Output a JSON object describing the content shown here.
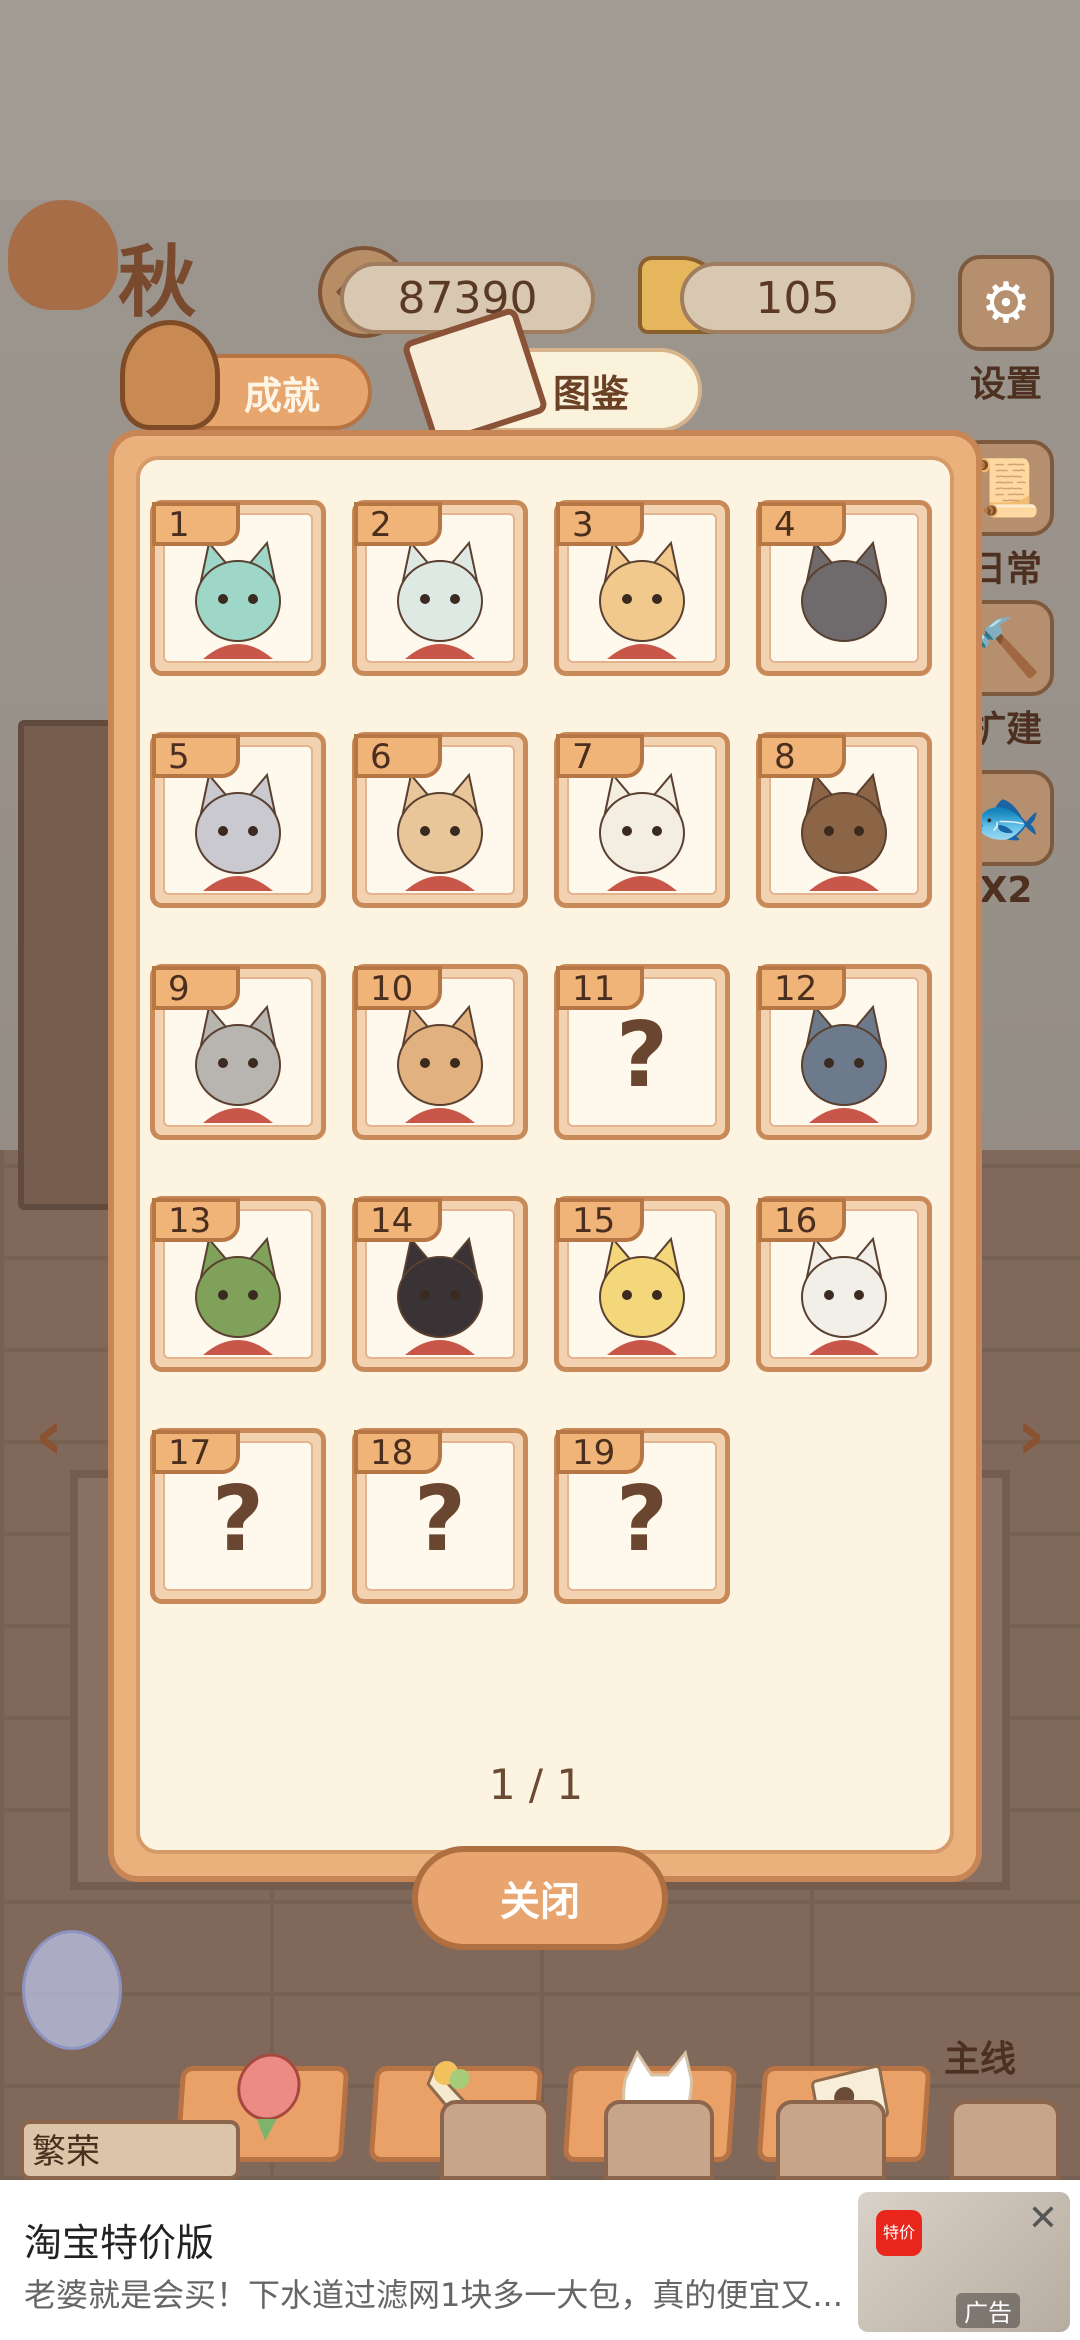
{
  "header": {
    "season": "秋",
    "fish_count": "87390",
    "cheese_count": "105"
  },
  "side_menu": {
    "settings": "设置",
    "daily": "日常",
    "build": "扩建",
    "double": "X2"
  },
  "tabs": {
    "achievements": "成就",
    "collection": "图鉴"
  },
  "collection": {
    "items": [
      {
        "number": "1",
        "unlocked": true,
        "character": "green-bird",
        "color": "#9ed7c8"
      },
      {
        "number": "2",
        "unlocked": true,
        "character": "white-dragon",
        "color": "#dfe9e4"
      },
      {
        "number": "3",
        "unlocked": true,
        "character": "unicorn-deer",
        "color": "#f2c98c"
      },
      {
        "number": "4",
        "unlocked": false,
        "silhouette": true,
        "character": "bear-silhouette",
        "color": "#6f6a6c"
      },
      {
        "number": "5",
        "unlocked": true,
        "character": "gray-cat",
        "color": "#c9c9cf"
      },
      {
        "number": "6",
        "unlocked": true,
        "character": "mouse-top-hat",
        "color": "#e8c69a"
      },
      {
        "number": "7",
        "unlocked": true,
        "character": "white-rabbit",
        "color": "#f4ede2"
      },
      {
        "number": "8",
        "unlocked": true,
        "character": "brown-bear",
        "color": "#8c6446"
      },
      {
        "number": "9",
        "unlocked": true,
        "character": "raccoon",
        "color": "#b8b4b0"
      },
      {
        "number": "10",
        "unlocked": true,
        "character": "fox-dog",
        "color": "#e1b17f"
      },
      {
        "number": "11",
        "unlocked": false,
        "label": "?"
      },
      {
        "number": "12",
        "unlocked": true,
        "character": "gray-wolf",
        "color": "#6c7a8c"
      },
      {
        "number": "13",
        "unlocked": true,
        "character": "cowboy-frog",
        "color": "#7fa15a"
      },
      {
        "number": "14",
        "unlocked": true,
        "character": "crow-hood",
        "color": "#3a3335"
      },
      {
        "number": "15",
        "unlocked": true,
        "character": "alpaca",
        "color": "#f4d77a"
      },
      {
        "number": "16",
        "unlocked": true,
        "character": "white-fox",
        "color": "#f2efe8"
      },
      {
        "number": "17",
        "unlocked": false,
        "label": "?"
      },
      {
        "number": "18",
        "unlocked": false,
        "label": "?"
      },
      {
        "number": "19",
        "unlocked": false,
        "label": "?"
      }
    ],
    "filters": [
      "rose-icon",
      "bouquet-icon",
      "cat-silhouette-icon",
      "photo-icon"
    ],
    "page": "1 / 1",
    "close_label": "关闭"
  },
  "bottom": {
    "fruitful_label": "繁荣",
    "mainline_label": "主线"
  },
  "ad": {
    "title": "淘宝特价版",
    "description": "老婆就是会买！下水道过滤网1块多一大包，真的便宜又...",
    "logo_text": "特价",
    "tag": "广告",
    "close": "✕"
  },
  "colors": {
    "panel": "#eab17d",
    "panel_inner": "#fcf3e1",
    "accent_brown": "#6b4126",
    "tab_active": "#fbf2dc"
  }
}
